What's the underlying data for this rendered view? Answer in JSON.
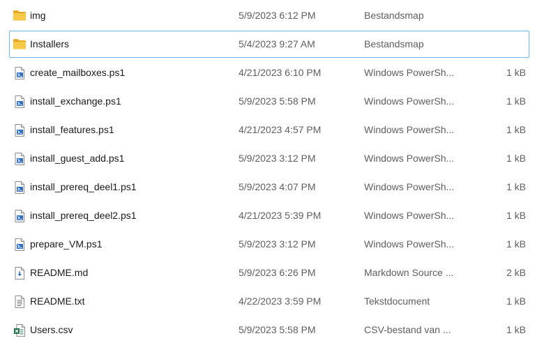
{
  "files": [
    {
      "name": "img",
      "date": "5/9/2023 6:12 PM",
      "type": "Bestandsmap",
      "size": "",
      "icon": "folder-icon"
    },
    {
      "name": "Installers",
      "date": "5/4/2023 9:27 AM",
      "type": "Bestandsmap",
      "size": "",
      "icon": "folder-icon"
    },
    {
      "name": "create_mailboxes.ps1",
      "date": "4/21/2023 6:10 PM",
      "type": "Windows PowerSh...",
      "size": "1 kB",
      "icon": "powershell-file-icon"
    },
    {
      "name": "install_exchange.ps1",
      "date": "5/9/2023 5:58 PM",
      "type": "Windows PowerSh...",
      "size": "1 kB",
      "icon": "powershell-file-icon"
    },
    {
      "name": "install_features.ps1",
      "date": "4/21/2023 4:57 PM",
      "type": "Windows PowerSh...",
      "size": "1 kB",
      "icon": "powershell-file-icon"
    },
    {
      "name": "install_guest_add.ps1",
      "date": "5/9/2023 3:12 PM",
      "type": "Windows PowerSh...",
      "size": "1 kB",
      "icon": "powershell-file-icon"
    },
    {
      "name": "install_prereq_deel1.ps1",
      "date": "5/9/2023 4:07 PM",
      "type": "Windows PowerSh...",
      "size": "1 kB",
      "icon": "powershell-file-icon"
    },
    {
      "name": "install_prereq_deel2.ps1",
      "date": "4/21/2023 5:39 PM",
      "type": "Windows PowerSh...",
      "size": "1 kB",
      "icon": "powershell-file-icon"
    },
    {
      "name": "prepare_VM.ps1",
      "date": "5/9/2023 3:12 PM",
      "type": "Windows PowerSh...",
      "size": "1 kB",
      "icon": "powershell-file-icon"
    },
    {
      "name": "README.md",
      "date": "5/9/2023 6:26 PM",
      "type": "Markdown Source ...",
      "size": "2 kB",
      "icon": "markdown-file-icon"
    },
    {
      "name": "README.txt",
      "date": "4/22/2023 3:59 PM",
      "type": "Tekstdocument",
      "size": "1 kB",
      "icon": "text-file-icon"
    },
    {
      "name": "Users.csv",
      "date": "5/9/2023 5:58 PM",
      "type": "CSV-bestand van ...",
      "size": "1 kB",
      "icon": "excel-csv-file-icon"
    }
  ],
  "colors": {
    "focus_border": "#6fb7e6",
    "folder": "#f5c542",
    "secondary_text": "#5e5e5e"
  }
}
